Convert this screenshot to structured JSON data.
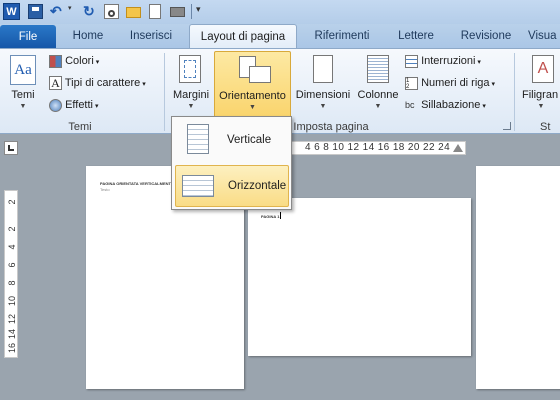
{
  "quick_access": {
    "items": [
      "word-logo",
      "save",
      "undo",
      "redo",
      "print-preview",
      "open",
      "new",
      "quick-print",
      "customize"
    ]
  },
  "tabs": [
    {
      "label": "File"
    },
    {
      "label": "Home"
    },
    {
      "label": "Inserisci"
    },
    {
      "label": "Layout di pagina"
    },
    {
      "label": "Riferimenti"
    },
    {
      "label": "Lettere"
    },
    {
      "label": "Revisione"
    },
    {
      "label": "Visua"
    }
  ],
  "ribbon": {
    "temi": {
      "button": "Temi",
      "colori": "Colori",
      "tipi": "Tipi di carattere",
      "effetti": "Effetti",
      "group": "Temi"
    },
    "imposta": {
      "margini": "Margini",
      "orientamento": "Orientamento",
      "dimensioni": "Dimensioni",
      "colonne": "Colonne",
      "interruzioni": "Interruzioni",
      "numeri": "Numeri di riga",
      "sillabazione": "Sillabazione",
      "group": "Imposta pagina"
    },
    "sfondo": {
      "filigrana": "Filigran",
      "group": "St"
    }
  },
  "ruler": {
    "numbers": "4  6  8 10 12 14 16 18 20 22 24"
  },
  "vruler": {
    "numbers": [
      "2",
      "2",
      "4",
      "6",
      "8",
      "10",
      "12",
      "14",
      "16",
      "18"
    ]
  },
  "dropdown": {
    "items": [
      {
        "label": "Verticale"
      },
      {
        "label": "Orizzontale"
      }
    ]
  },
  "pages": {
    "page1_text": "PAGINA ORIENTATA VERTICALMENTE",
    "page1_sub": "Testo",
    "page2_text": "PAGINA 1"
  }
}
